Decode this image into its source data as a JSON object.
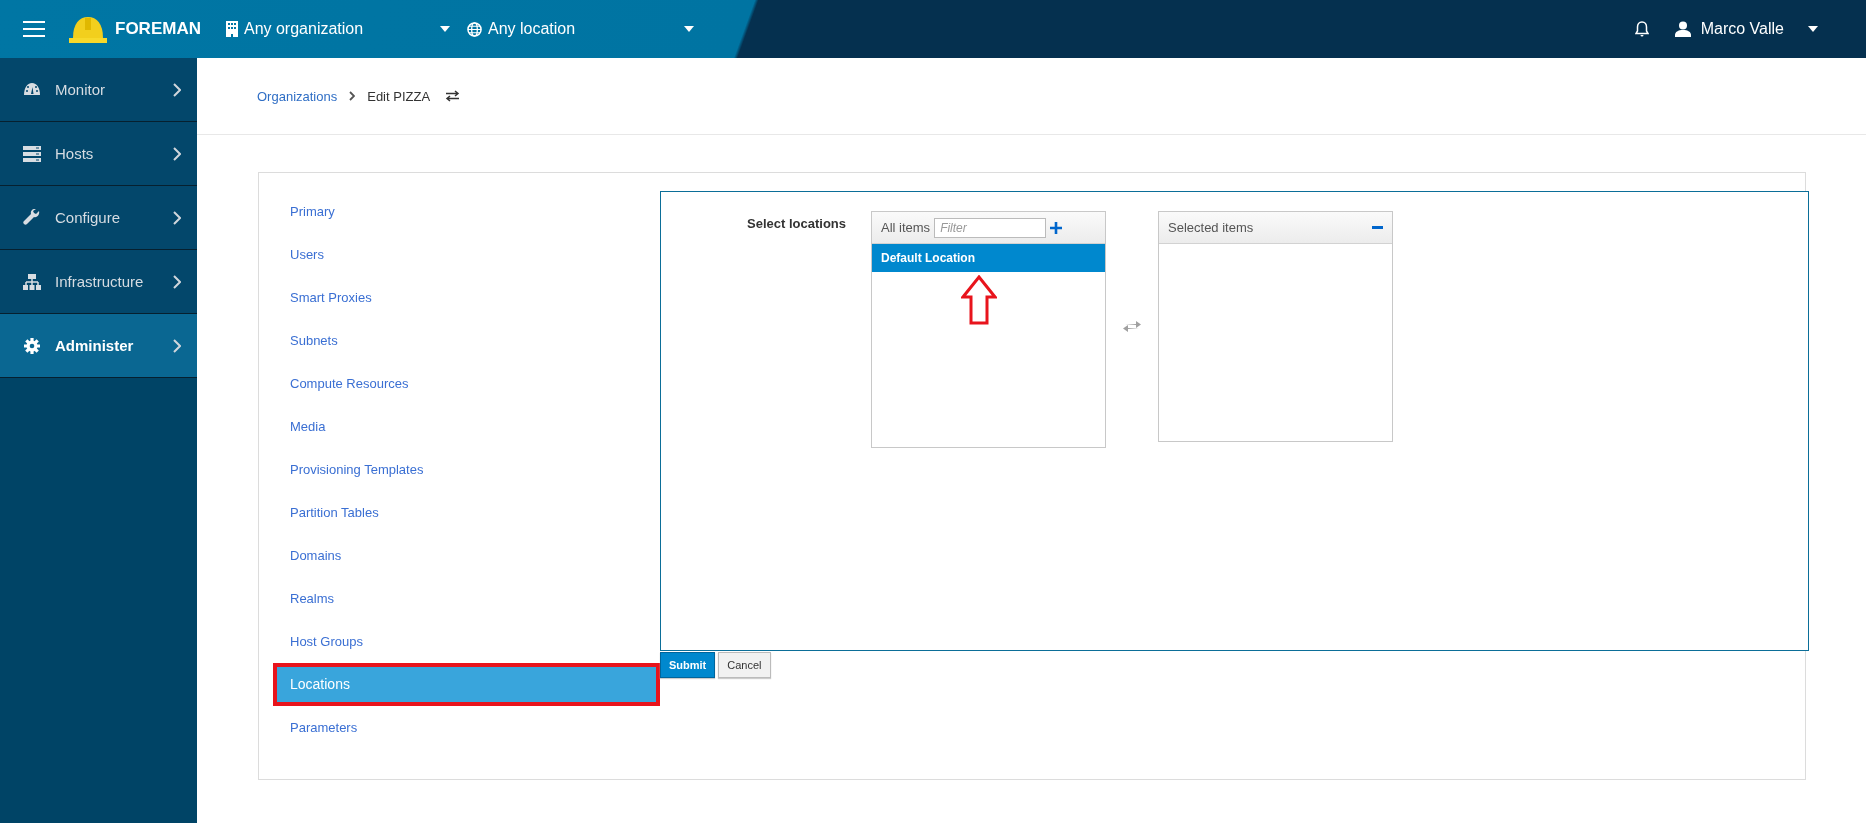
{
  "topbar": {
    "brand": "FOREMAN",
    "organization": "Any organization",
    "location": "Any location",
    "user": "Marco Valle"
  },
  "sidebar": {
    "items": [
      {
        "label": "Monitor",
        "selected": false
      },
      {
        "label": "Hosts",
        "selected": false
      },
      {
        "label": "Configure",
        "selected": false
      },
      {
        "label": "Infrastructure",
        "selected": false
      },
      {
        "label": "Administer",
        "selected": true
      }
    ]
  },
  "breadcrumb": {
    "parent": "Organizations",
    "current": "Edit PIZZA"
  },
  "tabs": [
    {
      "label": "Primary",
      "selected": false,
      "annotated": false
    },
    {
      "label": "Users",
      "selected": false,
      "annotated": false
    },
    {
      "label": "Smart Proxies",
      "selected": false,
      "annotated": false
    },
    {
      "label": "Subnets",
      "selected": false,
      "annotated": false
    },
    {
      "label": "Compute Resources",
      "selected": false,
      "annotated": false
    },
    {
      "label": "Media",
      "selected": false,
      "annotated": false
    },
    {
      "label": "Provisioning Templates",
      "selected": false,
      "annotated": false
    },
    {
      "label": "Partition Tables",
      "selected": false,
      "annotated": false
    },
    {
      "label": "Domains",
      "selected": false,
      "annotated": false
    },
    {
      "label": "Realms",
      "selected": false,
      "annotated": false
    },
    {
      "label": "Host Groups",
      "selected": false,
      "annotated": false
    },
    {
      "label": "Locations",
      "selected": true,
      "annotated": true
    },
    {
      "label": "Parameters",
      "selected": false,
      "annotated": false
    }
  ],
  "form": {
    "label": "Select locations",
    "available": {
      "header": "All items",
      "filter_placeholder": "Filter",
      "items": [
        {
          "label": "Default Location",
          "selected": true,
          "annotated": true
        }
      ]
    },
    "chosen": {
      "header": "Selected items"
    }
  },
  "buttons": [
    {
      "label": "Submit",
      "kind": "primary"
    },
    {
      "label": "Cancel",
      "kind": "default"
    }
  ]
}
